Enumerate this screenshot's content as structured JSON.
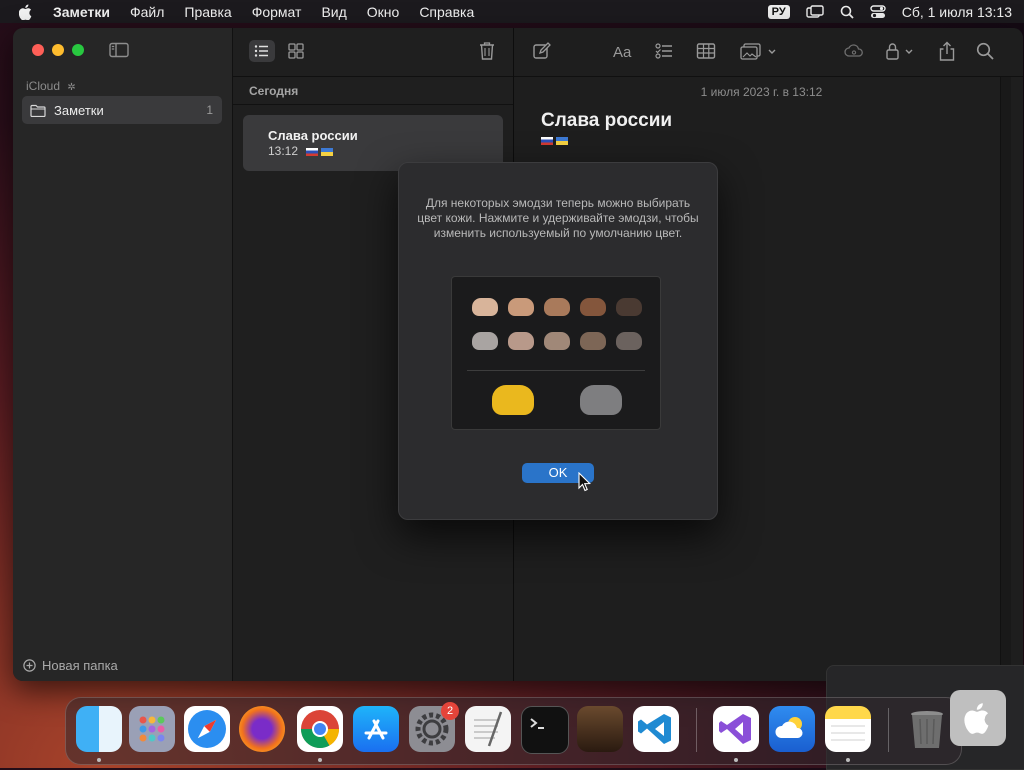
{
  "menubar": {
    "app_name": "Заметки",
    "items": [
      "Файл",
      "Правка",
      "Формат",
      "Вид",
      "Окно",
      "Справка"
    ],
    "lang": "РУ",
    "clock": "Сб, 1 июля  13:13"
  },
  "sidebar": {
    "account_label": "iCloud",
    "folder": {
      "label": "Заметки",
      "count": "1"
    },
    "new_folder_label": "Новая папка"
  },
  "notelist": {
    "section_title": "Сегодня",
    "note": {
      "title": "Слава россии",
      "time": "13:12"
    }
  },
  "editor": {
    "date": "1 июля 2023 г. в 13:12",
    "title": "Слава россии"
  },
  "dialog": {
    "text": "Для некоторых эмодзи теперь можно выбирать цвет кожи. Нажмите и удерживайте эмодзи, чтобы изменить используемый по умолчанию цвет.",
    "ok_label": "OK"
  },
  "dock": {
    "settings_badge": "2"
  },
  "colors": {
    "accent": "#2a74c9",
    "selected_row": "#3a3a3c",
    "badge_red": "#e5443a"
  },
  "icons": {
    "toolbar": [
      "compose-icon",
      "format-icon",
      "checklist-icon",
      "table-icon",
      "media-icon",
      "collaborate-icon",
      "lock-icon",
      "share-icon",
      "search-icon"
    ]
  }
}
